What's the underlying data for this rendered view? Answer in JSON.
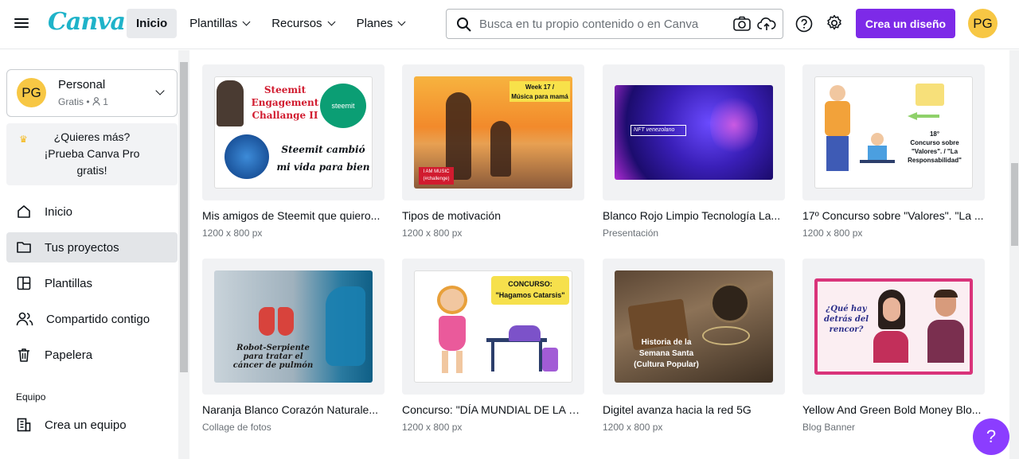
{
  "app": {
    "logo": "Canva"
  },
  "topnav": {
    "items": [
      {
        "label": "Inicio"
      },
      {
        "label": "Plantillas"
      },
      {
        "label": "Recursos"
      },
      {
        "label": "Planes"
      }
    ]
  },
  "search": {
    "placeholder": "Busca en tu propio contenido o en Canva"
  },
  "header": {
    "create_label": "Crea un diseño",
    "avatar_initials": "PG",
    "accent": "#7d2ae8"
  },
  "sidebar": {
    "team": {
      "initials": "PG",
      "name": "Personal",
      "plan": "Gratis",
      "members": "1"
    },
    "promo": {
      "line1": "¿Quieres más?",
      "line2": "¡Prueba Canva Pro",
      "line3": "gratis!"
    },
    "items": [
      {
        "label": "Inicio"
      },
      {
        "label": "Tus proyectos"
      },
      {
        "label": "Plantillas"
      },
      {
        "label": "Compartido contigo"
      },
      {
        "label": "Papelera"
      }
    ],
    "section_label": "Equipo",
    "create_team": "Crea un equipo"
  },
  "projects": [
    {
      "title": "Mis amigos de Steemit que quiero...",
      "meta": "1200 x 800 px",
      "thumb_text": [
        "Steemit",
        "Engagement",
        "Challange II",
        "steemit",
        "Steemit cambió",
        "mi vida para bien"
      ]
    },
    {
      "title": "Tipos de motivación",
      "meta": "1200 x 800 px",
      "thumb_text": [
        "Week 17 /",
        "Música para mamá",
        "I AM MUSIC",
        "(#challenge)"
      ]
    },
    {
      "title": "Blanco Rojo Limpio Tecnología La...",
      "meta": "Presentación",
      "thumb_text": [
        "NFT venezolano"
      ]
    },
    {
      "title": "17º Concurso sobre \"Valores\". \"La ...",
      "meta": "1200 x 800 px",
      "thumb_text": [
        "18°",
        "Concurso sobre",
        "\"Valores\". / \"La",
        "Responsabilidad\""
      ]
    },
    {
      "title": "Naranja Blanco Corazón Naturale...",
      "meta": "Collage de fotos",
      "thumb_text": [
        "Robot-Serpiente",
        "para tratar el",
        "cáncer de pulmón"
      ]
    },
    {
      "title": "Concurso: \"DÍA MUNDIAL DE LA S...",
      "meta": "1200 x 800 px",
      "thumb_text": [
        "CONCURSO:",
        "\"Hagamos Catarsis\""
      ]
    },
    {
      "title": "Digitel avanza hacia la red 5G",
      "meta": "1200 x 800 px",
      "thumb_text": [
        "Historia de la",
        "Semana Santa",
        "(Cultura Popular)"
      ]
    },
    {
      "title": "Yellow And Green Bold Money Blo...",
      "meta": "Blog Banner",
      "thumb_text": [
        "¿Qué hay",
        "detrás del",
        "rencor?"
      ]
    }
  ],
  "help_fab": "?"
}
